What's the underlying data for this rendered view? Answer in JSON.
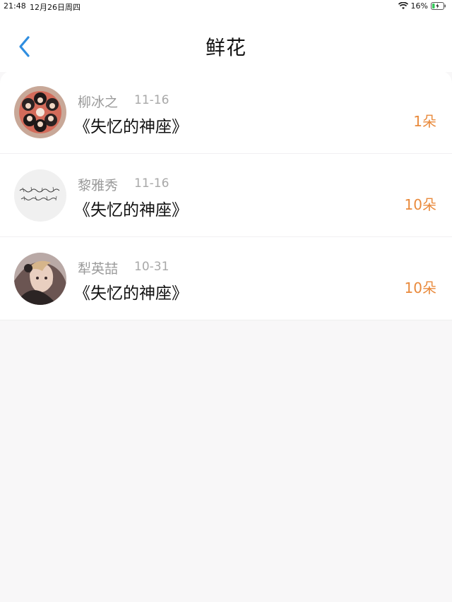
{
  "status_bar": {
    "time": "21:48",
    "date": "12月26日周四",
    "battery": "16%"
  },
  "nav": {
    "title": "鲜花",
    "back_icon": "chevron-left-icon"
  },
  "colors": {
    "accent": "#2f8ee0",
    "count": "#e98a3c",
    "muted": "#9a9a9a"
  },
  "flowers": [
    {
      "name": "柳冰之",
      "date": "11-16",
      "title": "《失忆的神座》",
      "count": "1朵"
    },
    {
      "name": "黎雅秀",
      "date": "11-16",
      "title": "《失忆的神座》",
      "count": "10朵"
    },
    {
      "name": "犁英喆",
      "date": "10-31",
      "title": "《失忆的神座》",
      "count": "10朵"
    }
  ]
}
